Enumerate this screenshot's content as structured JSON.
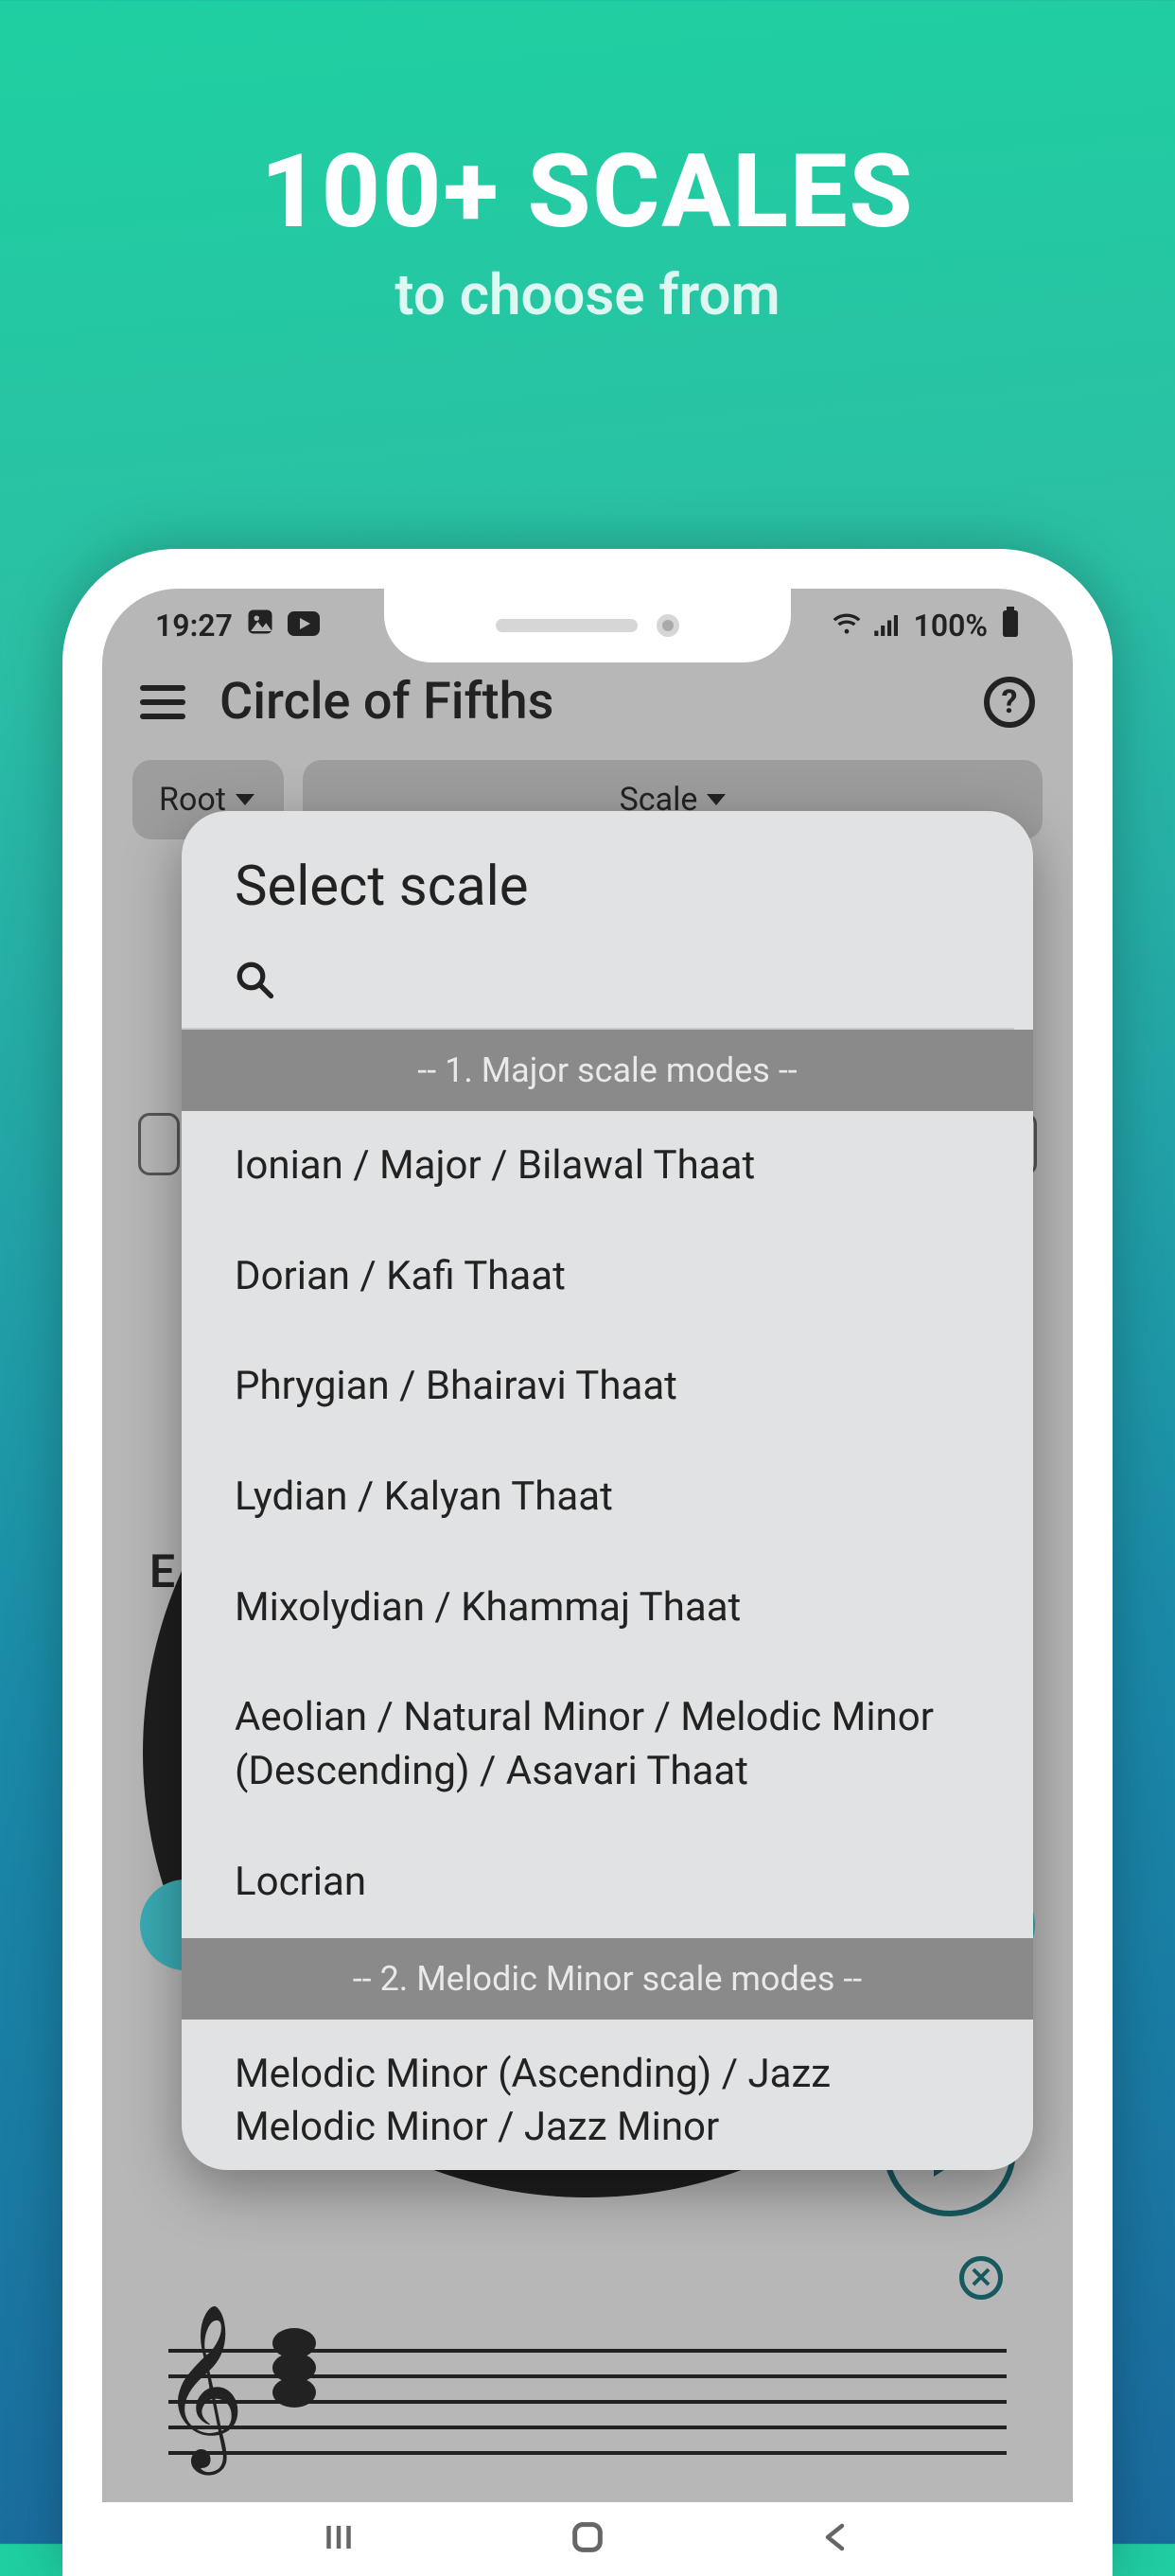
{
  "promo": {
    "title": "100+ SCALES",
    "subtitle": "to choose from"
  },
  "status": {
    "time": "19:27",
    "battery": "100%"
  },
  "header": {
    "title": "Circle of Fifths",
    "help": "?"
  },
  "dropdowns": {
    "root": "Root",
    "scale": "Scale"
  },
  "chip_right": "#",
  "modal": {
    "title": "Select scale",
    "search_placeholder": "",
    "sections": [
      {
        "header": "-- 1. Major scale modes --",
        "items": [
          "Ionian / Major / Bilawal Thaat",
          "Dorian / Kafi Thaat",
          "Phrygian / Bhairavi Thaat",
          "Lydian / Kalyan Thaat",
          "Mixolydian / Khammaj Thaat",
          "Aeolian / Natural Minor / Melodic Minor (Descending) / Asavari Thaat",
          "Locrian"
        ]
      },
      {
        "header": "-- 2. Melodic Minor scale modes --",
        "items": [
          "Melodic Minor (Ascending) / Jazz Melodic Minor / Jazz Minor"
        ]
      }
    ]
  }
}
